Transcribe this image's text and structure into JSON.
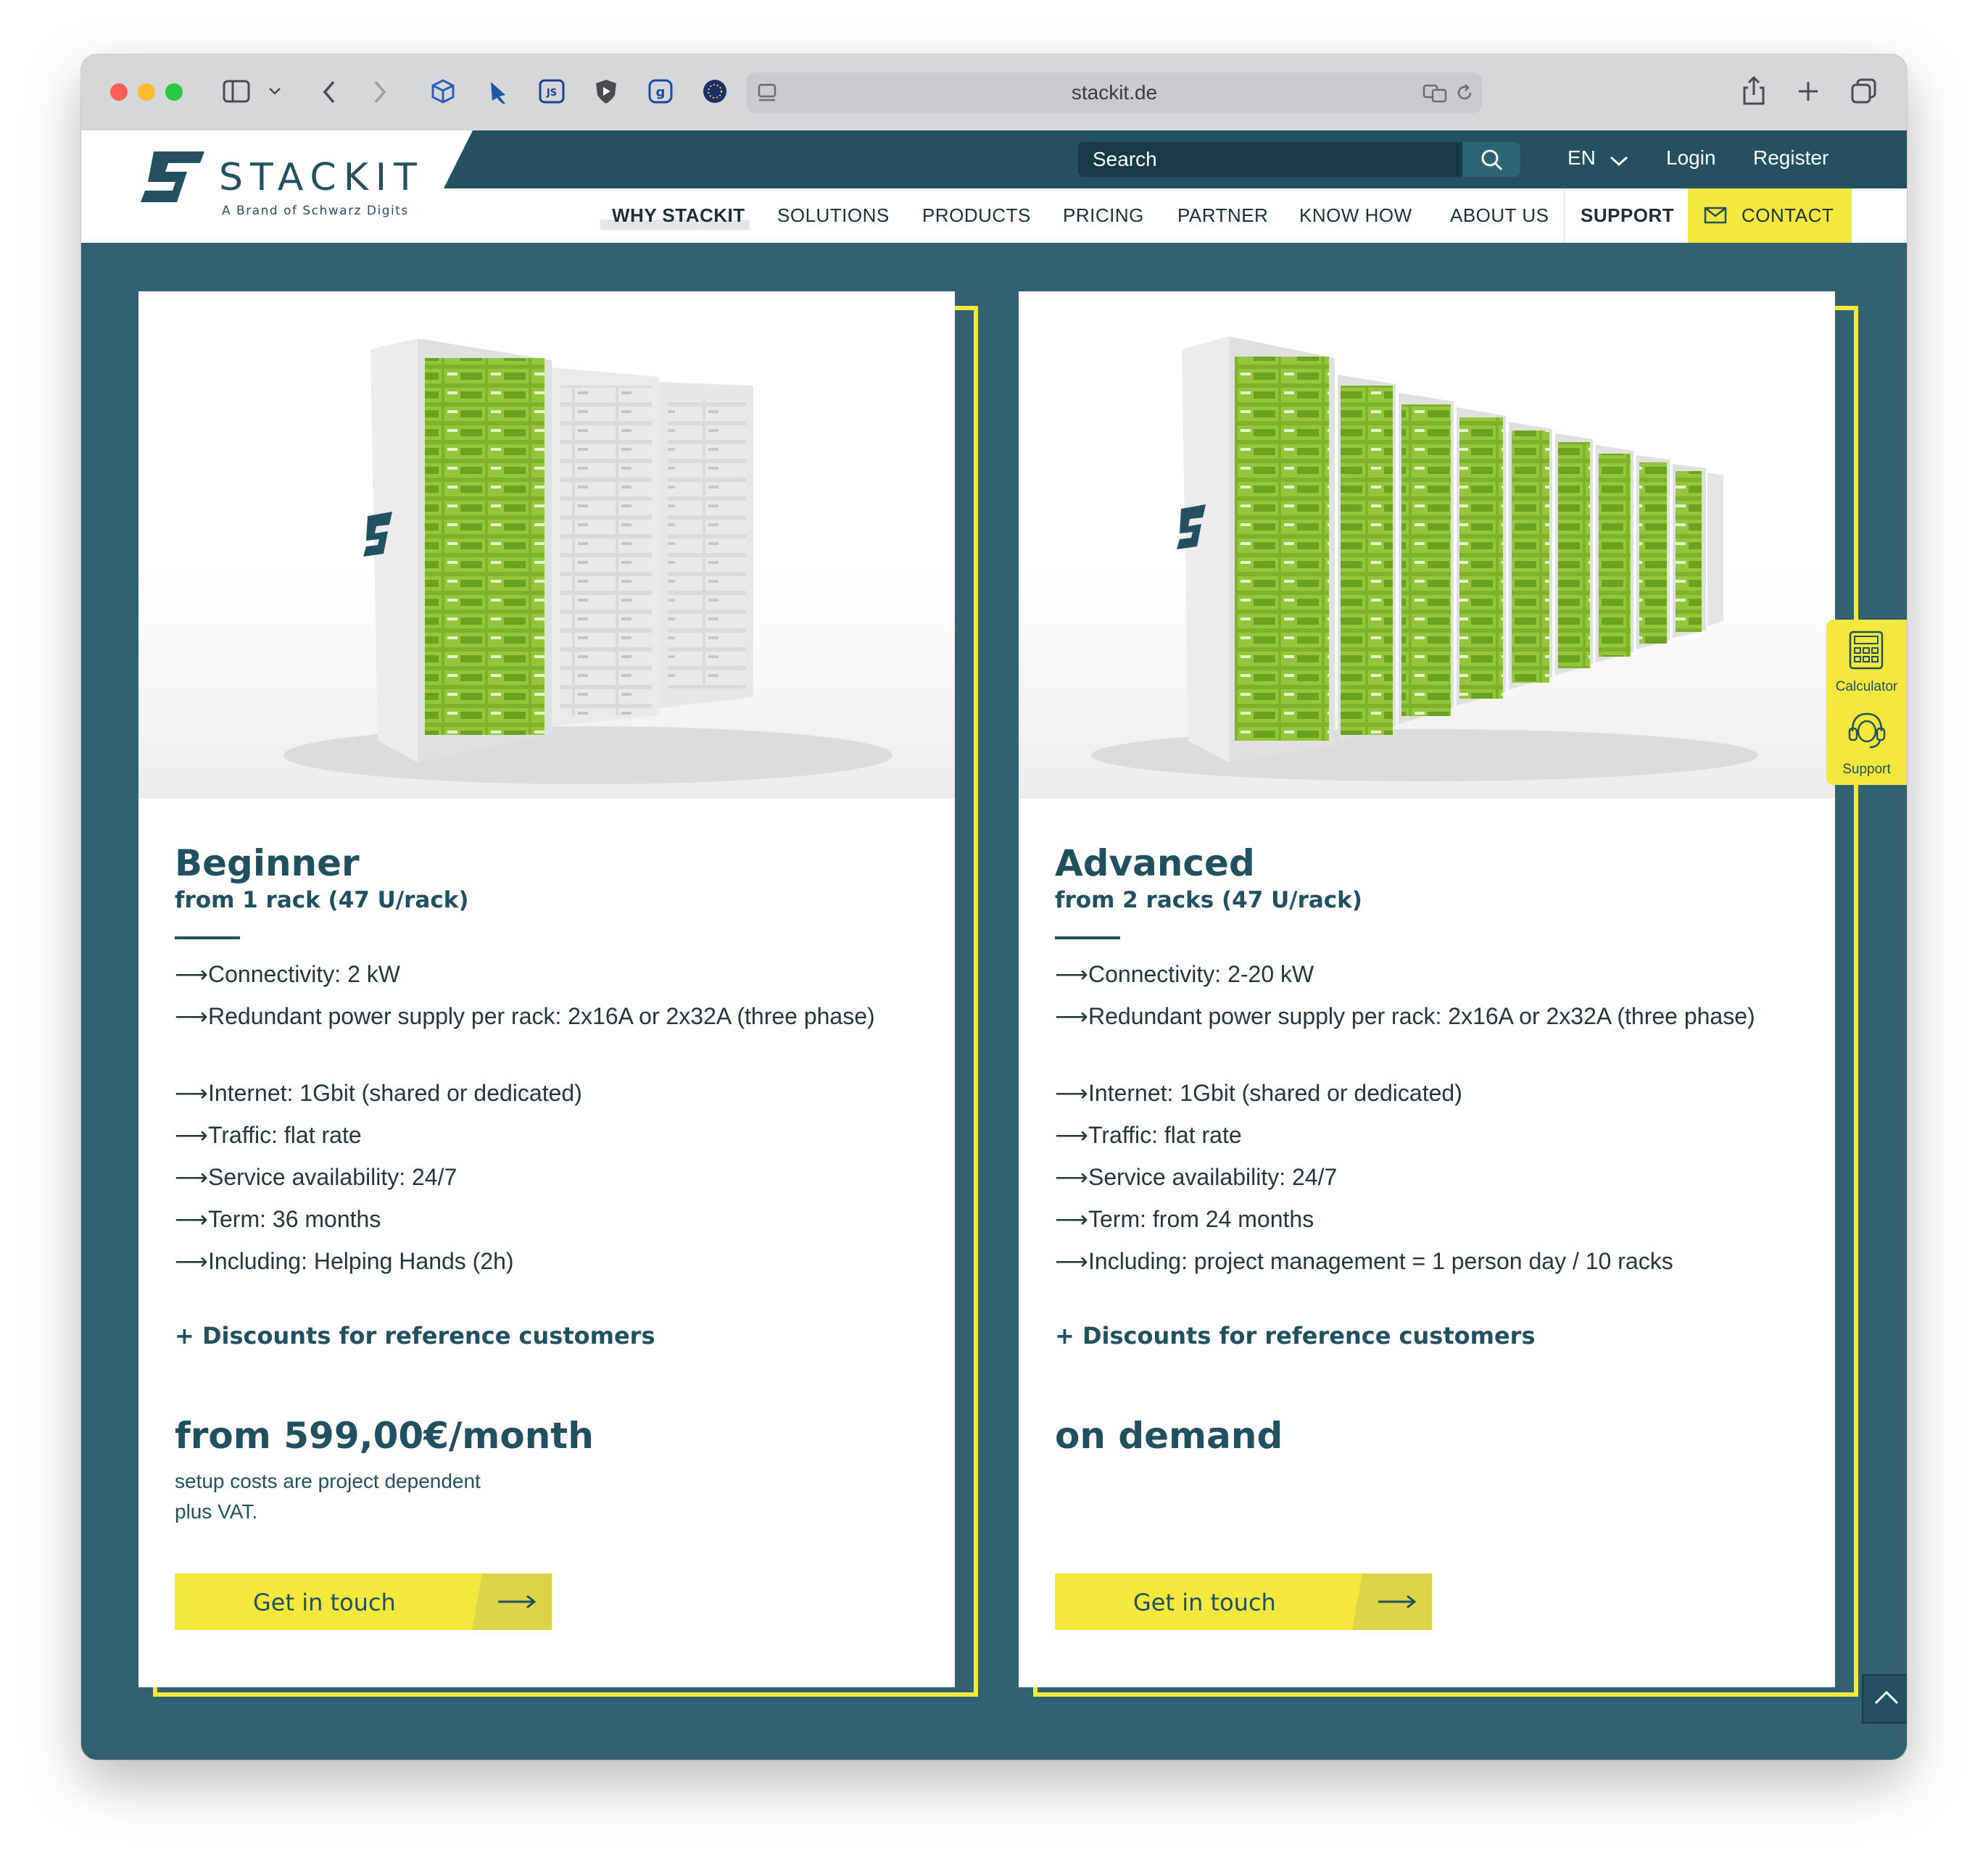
{
  "browser": {
    "url": "stackit.de"
  },
  "header": {
    "logo_text": "STACKIT",
    "logo_tagline": "A Brand of Schwarz Digits",
    "search_placeholder": "Search",
    "language": "EN",
    "login": "Login",
    "register": "Register"
  },
  "nav": {
    "items": [
      "WHY STACKIT",
      "SOLUTIONS",
      "PRODUCTS",
      "PRICING",
      "PARTNER",
      "KNOW HOW",
      "ABOUT US"
    ],
    "support": "SUPPORT",
    "contact": "CONTACT"
  },
  "side_widget": {
    "calculator": "Calculator",
    "support": "Support"
  },
  "cards": [
    {
      "title": "Beginner",
      "subtitle": "from 1 rack (47 U/rack)",
      "features": [
        "Connectivity: 2 kW",
        "Redundant power supply per rack: 2x16A or 2x32A (three phase)",
        "Internet: 1Gbit (shared or dedicated)",
        "Traffic: flat rate",
        "Service availability: 24/7",
        "Term: 36 months",
        "Including: Helping Hands (2h)"
      ],
      "discounts": "+ Discounts for reference customers",
      "price": "from 599,00€/month",
      "note_1": "setup costs are project dependent",
      "note_2": "plus VAT.",
      "button": "Get in touch"
    },
    {
      "title": "Advanced",
      "subtitle": "from 2 racks (47 U/rack)",
      "features": [
        "Connectivity: 2-20 kW",
        "Redundant power supply per rack: 2x16A or 2x32A (three phase)",
        "Internet: 1Gbit (shared or dedicated)",
        "Traffic: flat rate",
        "Service availability: 24/7",
        "Term: from 24 months",
        "Including: project management = 1 person day / 10 racks"
      ],
      "discounts": "+ Discounts for reference customers",
      "price": "on demand",
      "button": "Get in touch"
    }
  ],
  "colors": {
    "teal_dark": "#24505f",
    "teal_bg": "#33616f",
    "yellow": "#f3e93c",
    "rack_green": "#7fb12a"
  }
}
